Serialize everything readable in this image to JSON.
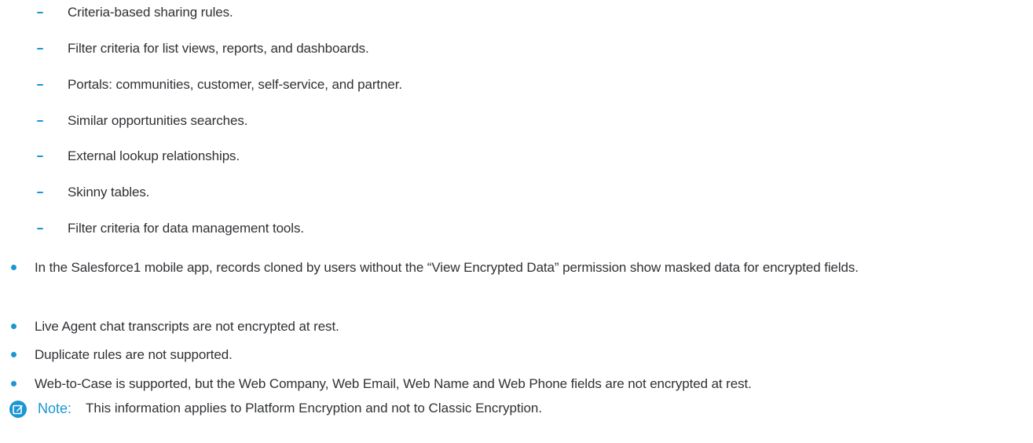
{
  "document": {
    "sub_items": [
      "Criteria-based sharing rules.",
      "Filter criteria for list views, reports, and dashboards.",
      "Portals: communities, customer, self-service, and partner.",
      "Similar opportunities searches.",
      "External lookup relationships.",
      "Skinny tables.",
      "Filter criteria for data management tools."
    ],
    "main_items": [
      "In the Salesforce1 mobile app, records cloned by users without the “View Encrypted Data” permission show masked data for encrypted fields.",
      "Live Agent chat transcripts are not encrypted at rest.",
      "Duplicate rules are not supported.",
      "Web-to-Case is supported, but the Web Company, Web Email, Web Name and Web Phone fields are not encrypted at rest."
    ],
    "note": {
      "label": "Note:",
      "text": "This information applies to Platform Encryption and not to Classic Encryption.",
      "icon": "edit-note-icon"
    }
  },
  "colors": {
    "accent": "#1b96d3",
    "text": "#2f3135"
  }
}
